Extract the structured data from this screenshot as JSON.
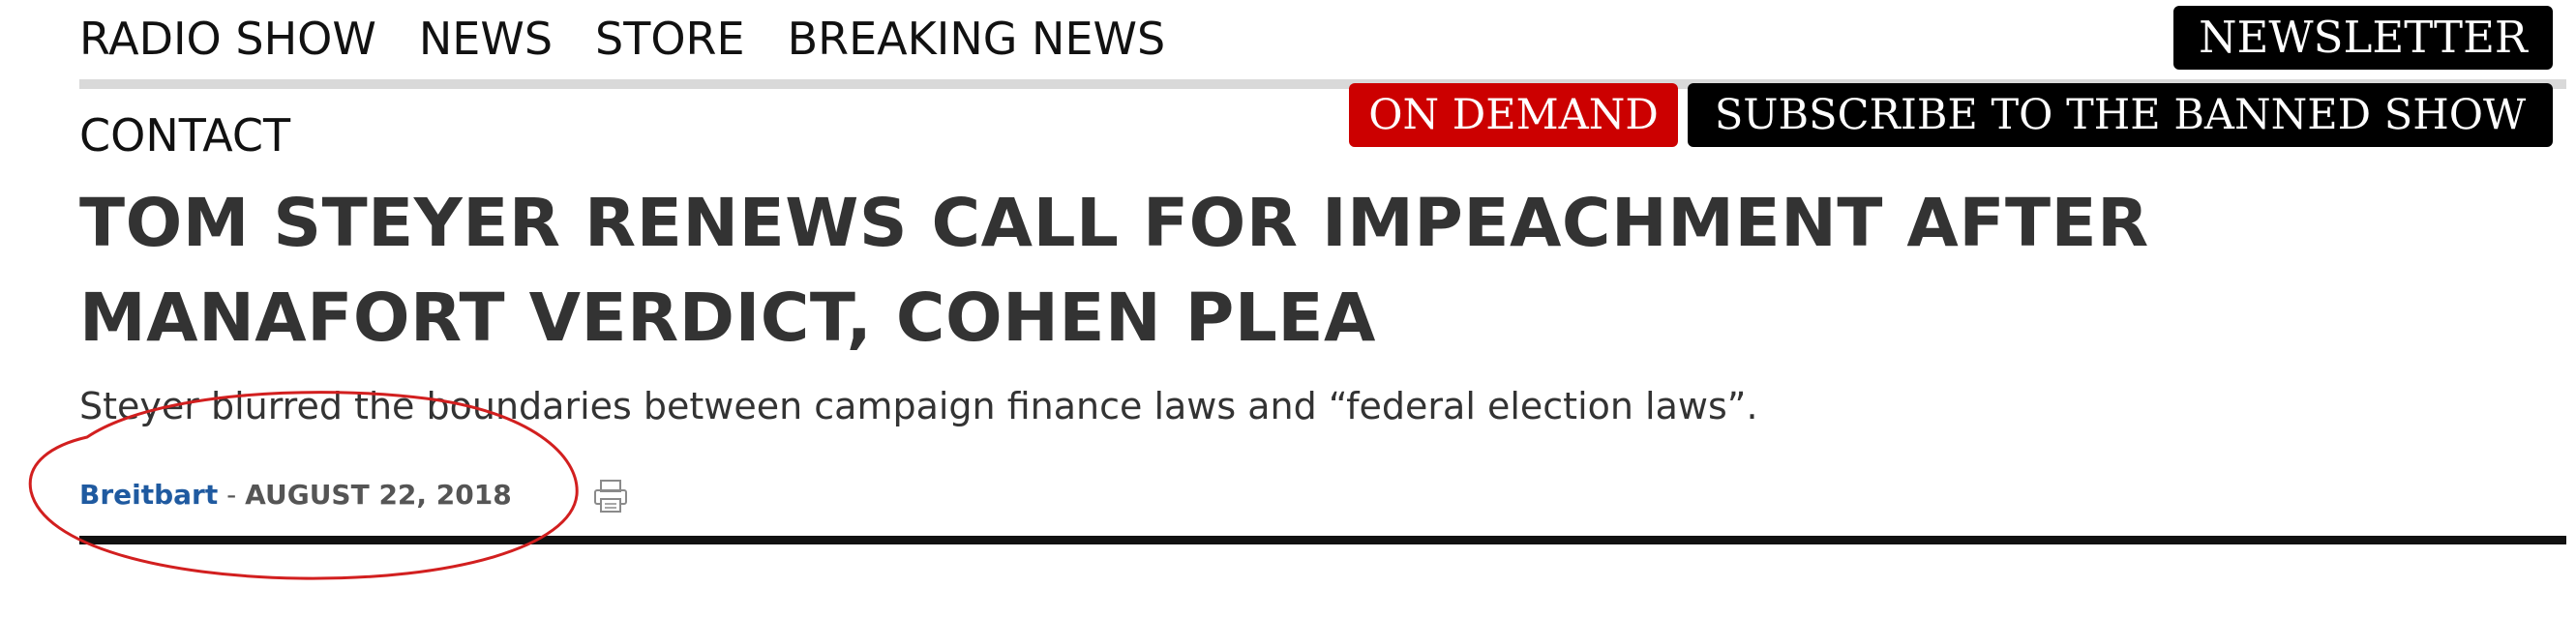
{
  "nav": {
    "items": [
      {
        "label": "RADIO SHOW"
      },
      {
        "label": "NEWS"
      },
      {
        "label": "STORE"
      },
      {
        "label": "BREAKING NEWS"
      }
    ],
    "contact": "CONTACT"
  },
  "buttons": {
    "newsletter": "NEWSLETTER",
    "on_demand": "ON DEMAND",
    "subscribe": "SUBSCRIBE TO THE BANNED SHOW"
  },
  "article": {
    "headline": "TOM STEYER RENEWS CALL FOR IMPEACHMENT AFTER MANAFORT VERDICT, COHEN PLEA",
    "subhead": "Steyer blurred the boundaries between campaign finance laws and “federal election laws”.",
    "author": "Breitbart",
    "separator": " - ",
    "date": "AUGUST 22, 2018"
  },
  "colors": {
    "on_demand_bg": "#cc0000",
    "author_link": "#1f5aa0",
    "annotation_circle": "#d21f1f",
    "headline_text": "#333333"
  },
  "icons": {
    "print": "print-icon"
  }
}
